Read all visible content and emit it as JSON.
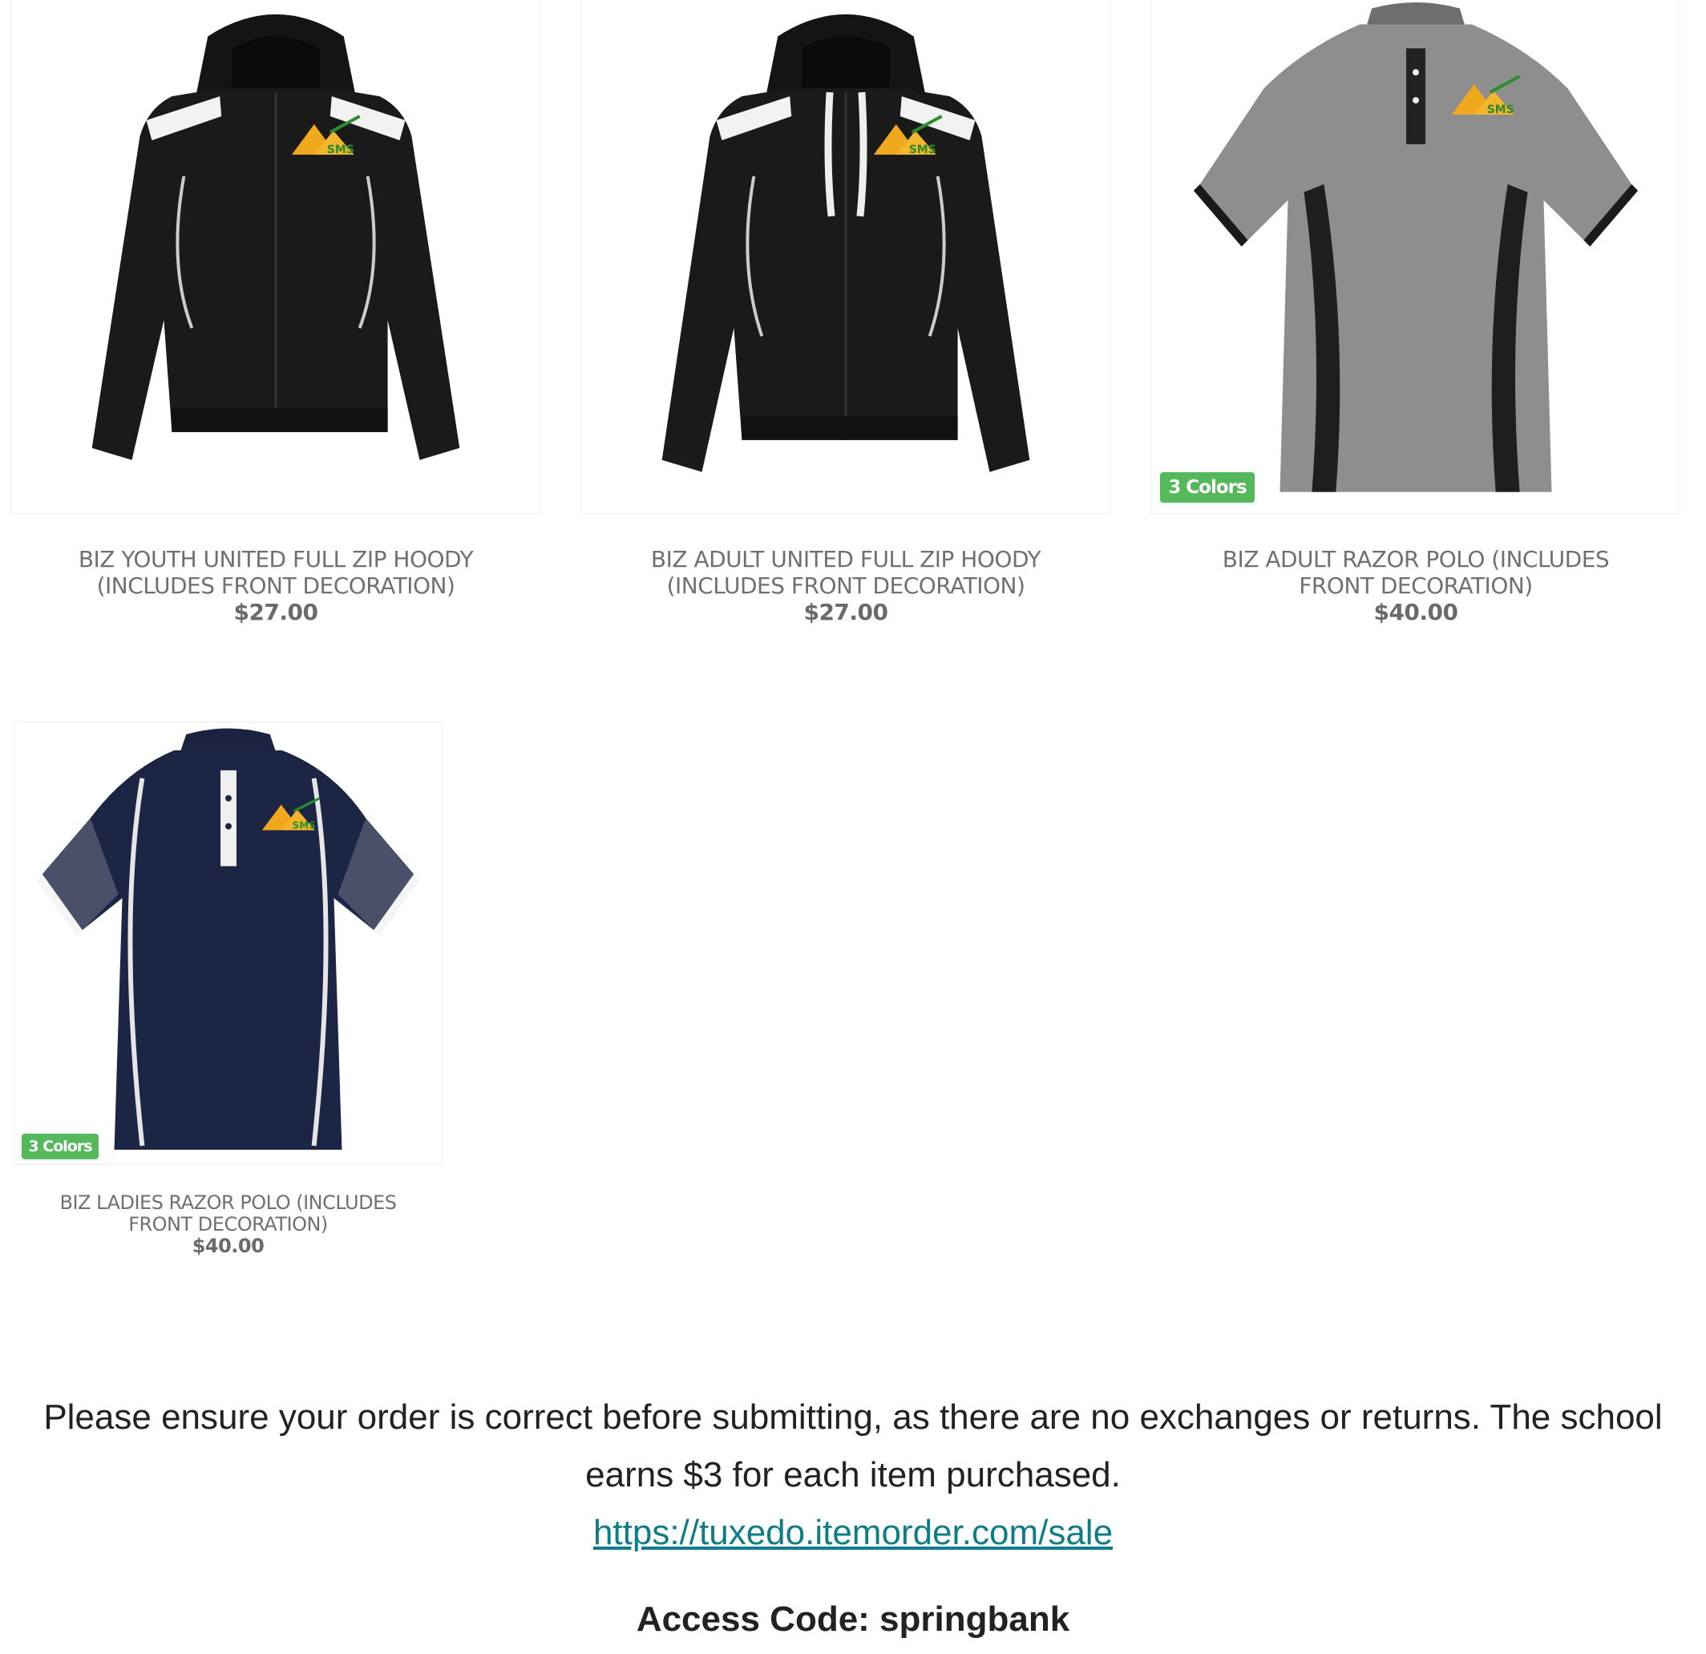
{
  "products": [
    {
      "name": "BIZ YOUTH UNITED FULL ZIP HOODY (INCLUDES FRONT DECORATION)",
      "price": "$27.00",
      "image": "black-youth-hoody-with-sms-logo"
    },
    {
      "name": "BIZ ADULT UNITED FULL ZIP HOODY (INCLUDES FRONT DECORATION)",
      "price": "$27.00",
      "image": "black-adult-hoody-with-drawstrings-sms-logo"
    },
    {
      "name": "BIZ ADULT RAZOR POLO (INCLUDES FRONT DECORATION)",
      "price": "$40.00",
      "badge": "3 Colors",
      "image": "grey-polo-with-black-trim-sms-logo"
    },
    {
      "name": "BIZ LADIES RAZOR POLO (INCLUDES FRONT DECORATION)",
      "price": "$40.00",
      "badge": "3 Colors",
      "image": "navy-ladies-polo-with-white-trim-sms-logo"
    }
  ],
  "logo_text": "SMS",
  "notice": {
    "message": "Please ensure your order is correct before submitting, as there are no exchanges or returns. The school earns $3 for each item purchased.",
    "link": "https://tuxedo.itemorder.com/sale",
    "access_code": "Access Code: springbank"
  },
  "colors": {
    "badge": "#55b85a",
    "link": "#0f7d86",
    "caption_text": "#707070",
    "logo_gold": "#f0a81e",
    "logo_green": "#2b8c2e"
  }
}
